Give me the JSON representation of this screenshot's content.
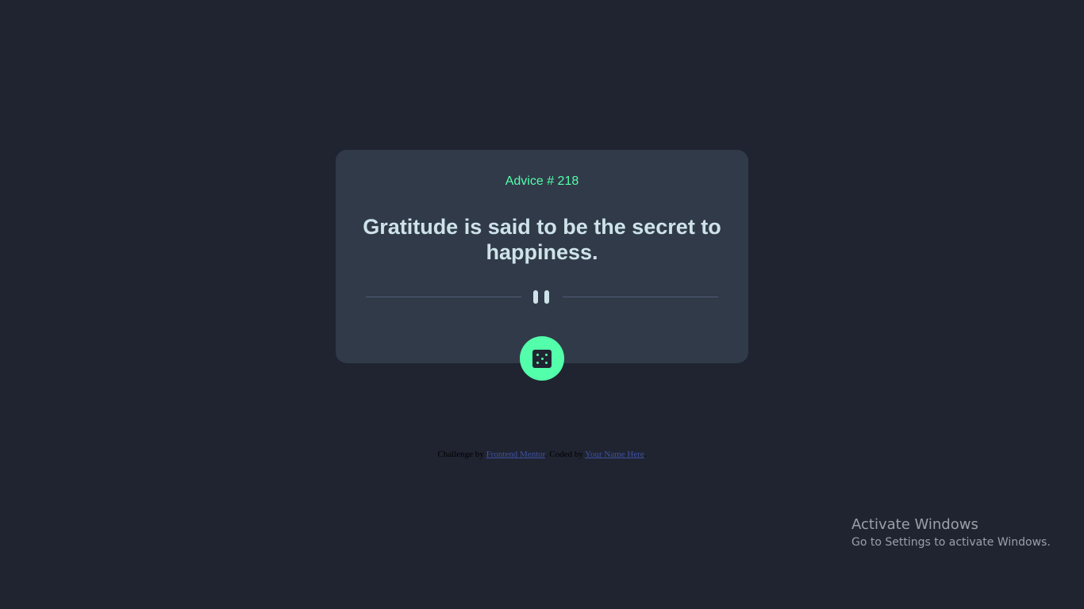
{
  "card": {
    "advice_id": "Advice # 218",
    "quote": "Gratitude is said to be the secret to happiness."
  },
  "button": {
    "icon": "dice-icon"
  },
  "footer": {
    "challenge_prefix": "Challenge by ",
    "challenge_link": "Frontend Mentor",
    "coded_prefix": ". Coded by ",
    "coded_link": "Your Name Here",
    "suffix": "."
  },
  "watermark": {
    "title": "Activate Windows",
    "subtitle": "Go to Settings to activate Windows."
  },
  "colors": {
    "background": "#202431",
    "card": "#313a49",
    "accent": "#53ffaa",
    "text": "#cee3e9",
    "divider": "#4f5d74"
  }
}
